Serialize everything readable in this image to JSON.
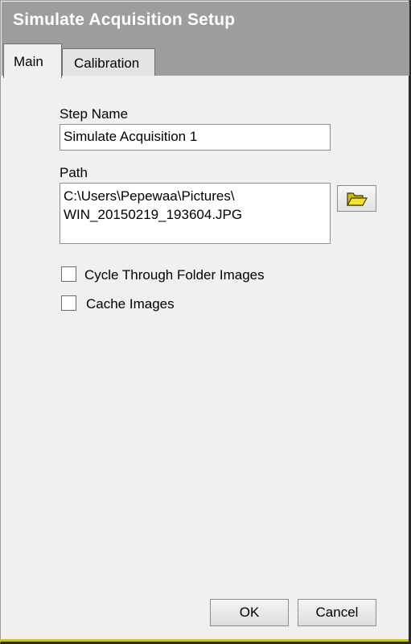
{
  "window": {
    "title": "Simulate Acquisition Setup"
  },
  "tabs": [
    {
      "label": "Main",
      "selected": true
    },
    {
      "label": "Calibration",
      "selected": false
    }
  ],
  "form": {
    "step_name": {
      "label": "Step Name",
      "value": "Simulate Acquisition 1"
    },
    "path": {
      "label": "Path",
      "value": "C:\\Users\\Pepewaa\\Pictures\\\nWIN_20150219_193604.JPG"
    },
    "browse_icon": "folder-open-icon",
    "checkboxes": [
      {
        "label": "Cycle Through Folder Images",
        "checked": false
      },
      {
        "label": "Cache Images",
        "checked": false
      }
    ]
  },
  "buttons": {
    "ok": "OK",
    "cancel": "Cancel"
  },
  "colors": {
    "titlebar": "#9d9d9d",
    "title_text": "#ffffff",
    "folder_icon": "#f2e32a"
  }
}
